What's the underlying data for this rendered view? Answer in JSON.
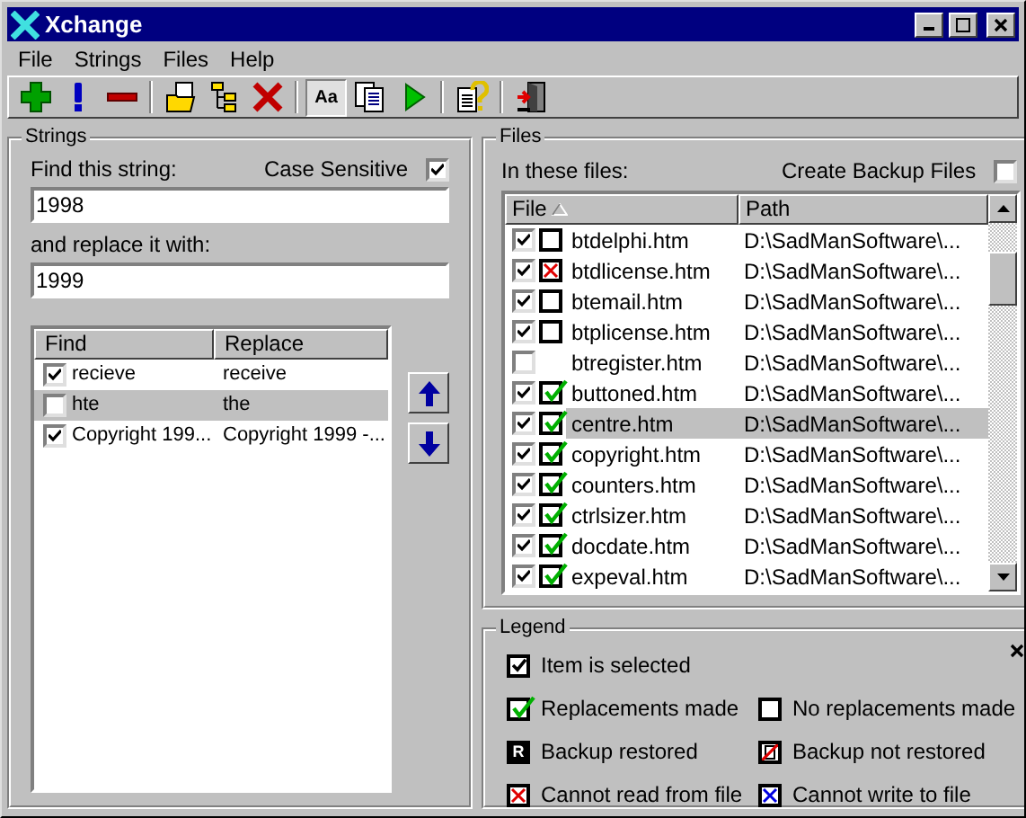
{
  "window": {
    "title": "Xchange"
  },
  "menu": [
    {
      "label": "File"
    },
    {
      "label": "Strings"
    },
    {
      "label": "Files"
    },
    {
      "label": "Help"
    }
  ],
  "toolbar": [
    {
      "kind": "add"
    },
    {
      "kind": "exclaim"
    },
    {
      "kind": "remove"
    },
    {
      "kind": "separator"
    },
    {
      "kind": "open"
    },
    {
      "kind": "tree"
    },
    {
      "kind": "delete"
    },
    {
      "kind": "separator"
    },
    {
      "kind": "case",
      "label": "Aa",
      "pressed": true
    },
    {
      "kind": "copy"
    },
    {
      "kind": "run"
    },
    {
      "kind": "separator"
    },
    {
      "kind": "help"
    },
    {
      "kind": "separator"
    },
    {
      "kind": "exit"
    }
  ],
  "strings_panel": {
    "title": "Strings",
    "find_label": "Find this string:",
    "case_sensitive": {
      "label": "Case Sensitive",
      "checked": true
    },
    "find_value": "1998",
    "replace_label": "and replace it with:",
    "replace_value": "1999",
    "columns": [
      "Find",
      "Replace"
    ],
    "rows": [
      {
        "checked": true,
        "find": "recieve",
        "replace": "receive",
        "selected": false
      },
      {
        "checked": false,
        "find": "hte",
        "replace": "the",
        "selected": true
      },
      {
        "checked": true,
        "find": "Copyright 199...",
        "replace": "Copyright 1999 -...",
        "selected": false
      }
    ]
  },
  "files_panel": {
    "title": "Files",
    "in_label": "In these files:",
    "create_backup": {
      "label": "Create Backup Files",
      "checked": false
    },
    "columns": [
      "File",
      "Path"
    ],
    "rows": [
      {
        "checked": true,
        "kind": "none",
        "file": "btdelphi.htm",
        "path": "D:\\SadManSoftware\\...",
        "selected": false
      },
      {
        "checked": true,
        "kind": "cannot_read",
        "file": "btdlicense.htm",
        "path": "D:\\SadManSoftware\\...",
        "selected": false
      },
      {
        "checked": true,
        "kind": "none",
        "file": "btemail.htm",
        "path": "D:\\SadManSoftware\\...",
        "selected": false
      },
      {
        "checked": true,
        "kind": "none",
        "file": "btplicense.htm",
        "path": "D:\\SadManSoftware\\...",
        "selected": false
      },
      {
        "checked": false,
        "kind": "hidden",
        "file": "btregister.htm",
        "path": "D:\\SadManSoftware\\...",
        "selected": false
      },
      {
        "checked": true,
        "kind": "replaced",
        "file": "buttoned.htm",
        "path": "D:\\SadManSoftware\\...",
        "selected": false
      },
      {
        "checked": true,
        "kind": "replaced",
        "file": "centre.htm",
        "path": "D:\\SadManSoftware\\...",
        "selected": true
      },
      {
        "checked": true,
        "kind": "replaced",
        "file": "copyright.htm",
        "path": "D:\\SadManSoftware\\...",
        "selected": false
      },
      {
        "checked": true,
        "kind": "replaced",
        "file": "counters.htm",
        "path": "D:\\SadManSoftware\\...",
        "selected": false
      },
      {
        "checked": true,
        "kind": "replaced",
        "file": "ctrlsizer.htm",
        "path": "D:\\SadManSoftware\\...",
        "selected": false
      },
      {
        "checked": true,
        "kind": "replaced",
        "file": "docdate.htm",
        "path": "D:\\SadManSoftware\\...",
        "selected": false
      },
      {
        "checked": true,
        "kind": "replaced",
        "file": "expeval.htm",
        "path": "D:\\SadManSoftware\\...",
        "selected": false
      }
    ]
  },
  "legend": {
    "title": "Legend",
    "items": [
      {
        "kind": "selected",
        "label": "Item is selected"
      },
      {
        "kind": "replaced",
        "label": "Replacements made"
      },
      {
        "kind": "none",
        "label": "No replacements made"
      },
      {
        "kind": "restored",
        "glyph": "R",
        "label": "Backup restored"
      },
      {
        "kind": "not_restored",
        "label": "Backup not restored"
      },
      {
        "kind": "cannot_read",
        "label": "Cannot read from file"
      },
      {
        "kind": "cannot_write",
        "label": "Cannot write to file"
      }
    ]
  }
}
